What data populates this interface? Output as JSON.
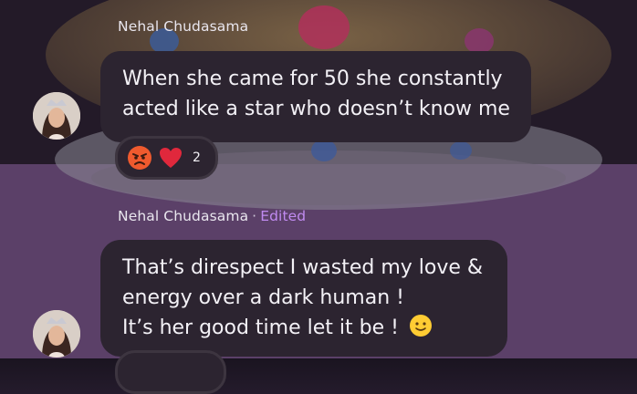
{
  "messages": [
    {
      "sender": "Nehal Chudasama",
      "edited_label": "",
      "lines": [
        "When she came for 50 she constantly",
        "acted like a star who doesn’t know me"
      ],
      "reaction_count": "2"
    },
    {
      "sender": "Nehal Chudasama",
      "separator": "·",
      "edited_label": "Edited",
      "lines": [
        "That’s direspect I wasted my love &",
        "energy over a dark human !",
        "It’s her good time let it be !"
      ]
    }
  ],
  "icons": {
    "avatar": "avatar-photo",
    "reaction_1": "angry-face-icon",
    "reaction_2": "red-heart-icon",
    "inline": "slightly-smiling-face-icon"
  },
  "colors": {
    "bubble": "#2c2430",
    "edited": "#c08af0",
    "heart": "#e0283c"
  }
}
